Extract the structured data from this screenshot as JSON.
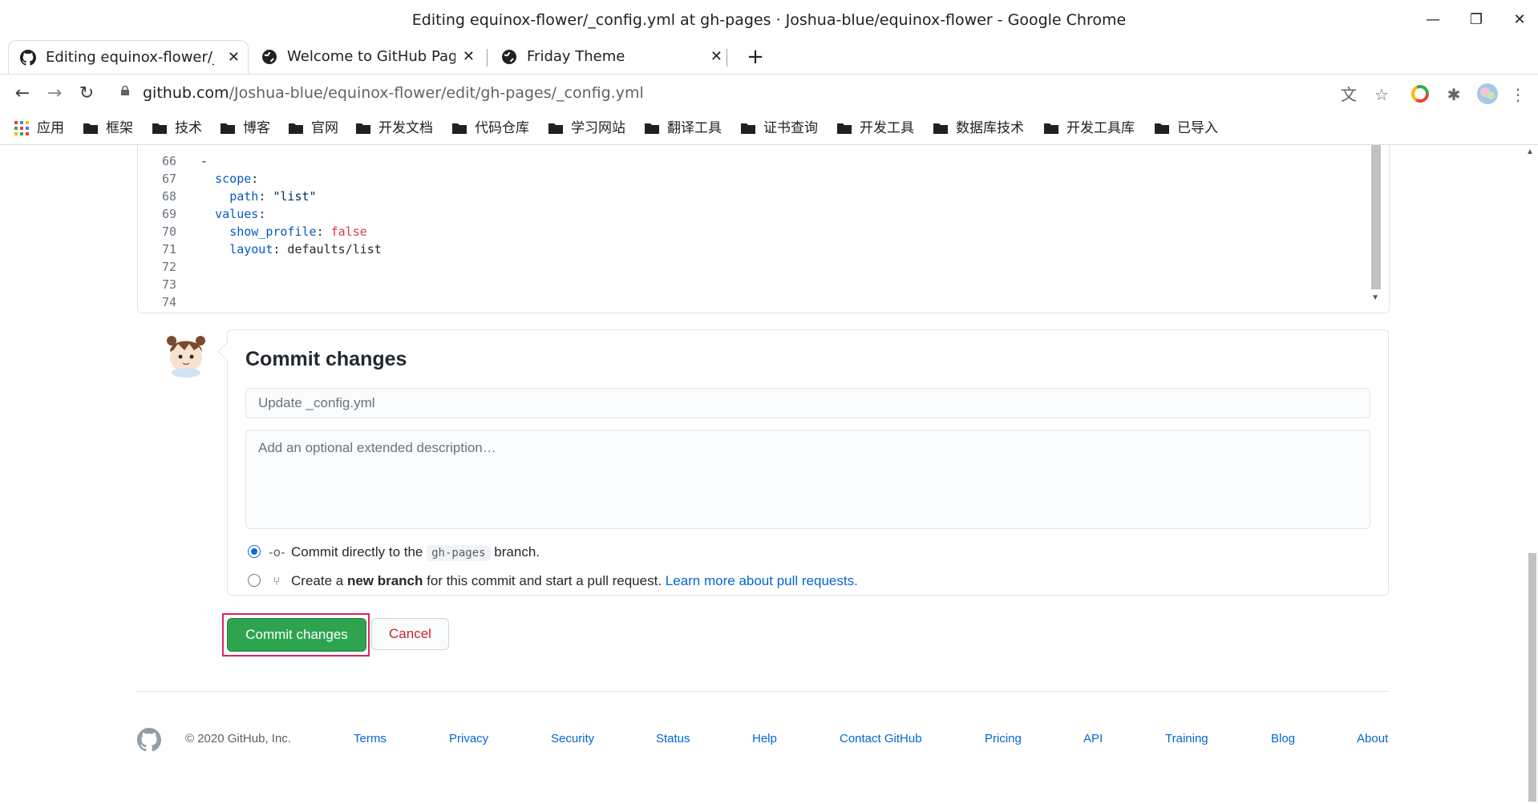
{
  "window": {
    "title": "Editing equinox-flower/_config.yml at gh-pages · Joshua-blue/equinox-flower - Google Chrome",
    "minimize": "—",
    "restore": "❐",
    "close": "✕"
  },
  "tabs": [
    {
      "label": "Editing equinox-flower/_co",
      "close": "✕"
    },
    {
      "label": "Welcome to GitHub Pages",
      "close": "✕"
    },
    {
      "label": "Friday Theme",
      "close": "✕"
    }
  ],
  "new_tab": "+",
  "toolbar": {
    "back": "←",
    "forward": "→",
    "reload": "↻",
    "url_host": "github.com",
    "url_path": "/Joshua-blue/equinox-flower/edit/gh-pages/_config.yml",
    "translate": "文",
    "star": "☆",
    "extensions": "✱",
    "menu": "⋮"
  },
  "bookmarks": [
    "应用",
    "框架",
    "技术",
    "博客",
    "官网",
    "开发文档",
    "代码仓库",
    "学习网站",
    "翻译工具",
    "证书查询",
    "开发工具",
    "数据库技术",
    "开发工具库",
    "已导入"
  ],
  "editor": {
    "lines": [
      {
        "n": "66",
        "segs": [
          {
            "t": "  -",
            "c": ""
          }
        ]
      },
      {
        "n": "67",
        "segs": [
          {
            "t": "    ",
            "c": ""
          },
          {
            "t": "scope",
            "c": "k"
          },
          {
            "t": ":",
            "c": ""
          }
        ]
      },
      {
        "n": "68",
        "segs": [
          {
            "t": "      ",
            "c": ""
          },
          {
            "t": "path",
            "c": "k"
          },
          {
            "t": ": ",
            "c": ""
          },
          {
            "t": "\"list\"",
            "c": "s"
          }
        ]
      },
      {
        "n": "69",
        "segs": [
          {
            "t": "    ",
            "c": ""
          },
          {
            "t": "values",
            "c": "k"
          },
          {
            "t": ":",
            "c": ""
          }
        ]
      },
      {
        "n": "70",
        "segs": [
          {
            "t": "      ",
            "c": ""
          },
          {
            "t": "show_profile",
            "c": "k"
          },
          {
            "t": ": ",
            "c": ""
          },
          {
            "t": "false",
            "c": "f"
          }
        ]
      },
      {
        "n": "71",
        "segs": [
          {
            "t": "      ",
            "c": ""
          },
          {
            "t": "layout",
            "c": "k"
          },
          {
            "t": ": defaults/list",
            "c": ""
          }
        ]
      },
      {
        "n": "72",
        "segs": []
      },
      {
        "n": "73",
        "segs": []
      },
      {
        "n": "74",
        "segs": []
      }
    ]
  },
  "commit": {
    "title": "Commit changes",
    "summary_placeholder": "Update _config.yml",
    "description_placeholder": "Add an optional extended description…",
    "option_direct_prefix": "Commit directly to the",
    "branch": "gh-pages",
    "option_direct_suffix": "branch.",
    "option_new_prefix": "Create a",
    "option_new_bold": "new branch",
    "option_new_suffix": "for this commit and start a pull request.",
    "learn_more": "Learn more about pull requests.",
    "commit_button": "Commit changes",
    "cancel_button": "Cancel"
  },
  "footer": {
    "copyright": "© 2020 GitHub, Inc.",
    "links": [
      "Terms",
      "Privacy",
      "Security",
      "Status",
      "Help",
      "Contact GitHub",
      "Pricing",
      "API",
      "Training",
      "Blog",
      "About"
    ]
  },
  "colors": {
    "primary_button": "#2ea44f",
    "link": "#0366d6",
    "cancel_text": "#cb2431",
    "highlight_box": "#e0245e"
  }
}
